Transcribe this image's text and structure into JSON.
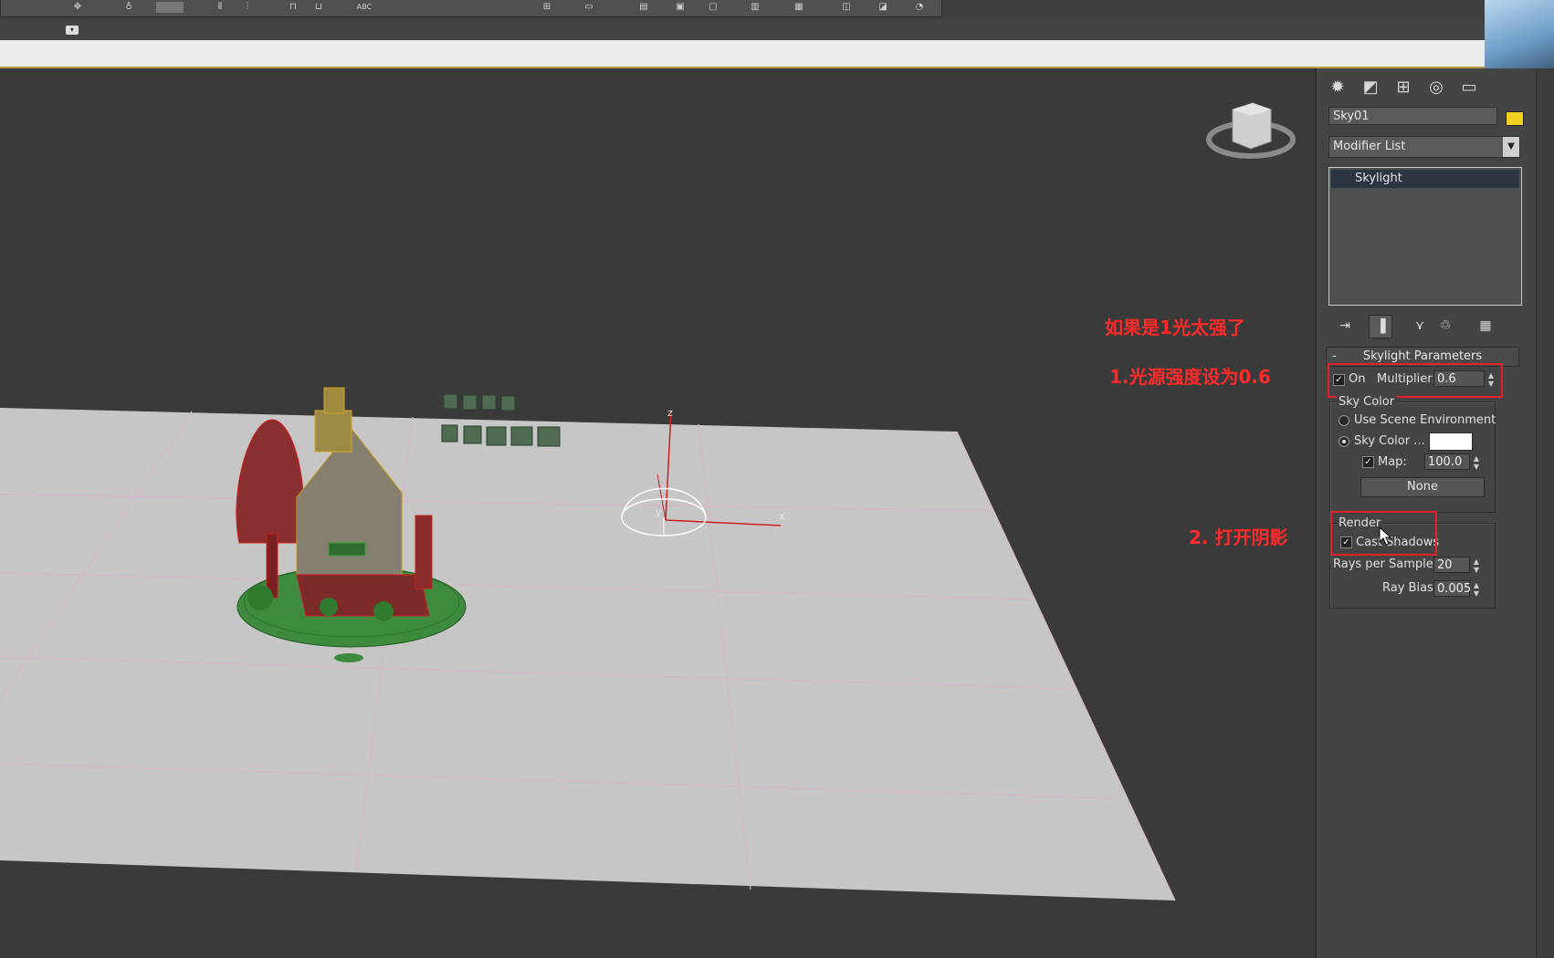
{
  "toolbar": {
    "label_abc": "ABC"
  },
  "command_panel": {
    "tabs": [
      "create-tab",
      "modify-tab",
      "hierarchy-tab",
      "motion-tab",
      "display-tab"
    ],
    "object_name": "Sky01",
    "object_color": "#f2d022",
    "modifier_list": "Modifier List",
    "stack_item": "Skylight",
    "skylight_params": {
      "title": "Skylight Parameters",
      "collapse": "-",
      "on_label": "On",
      "multiplier_label": "Multiplier:",
      "multiplier_value": "0.6",
      "sky_color_group": "Sky Color",
      "use_scene_env": "Use Scene Environment",
      "sky_color_label": "Sky Color ...",
      "sky_color_swatch": "#ffffff",
      "map_label": "Map:",
      "map_value": "100.0",
      "map_button": "None",
      "render_group": "Render",
      "cast_shadows": "Cast Shadows",
      "rays_label": "Rays per Sample:",
      "rays_value": "20",
      "bias_label": "Ray Bias:",
      "bias_value": "0.005"
    }
  },
  "viewport": {
    "axis_z": "z",
    "axis_y": "y",
    "axis_x": "x"
  },
  "annotations": {
    "line1": "如果是1光太强了",
    "line2": "1.光源强度设为0.6",
    "line3": "2. 打开阴影",
    "color": "#ff2a2a"
  }
}
